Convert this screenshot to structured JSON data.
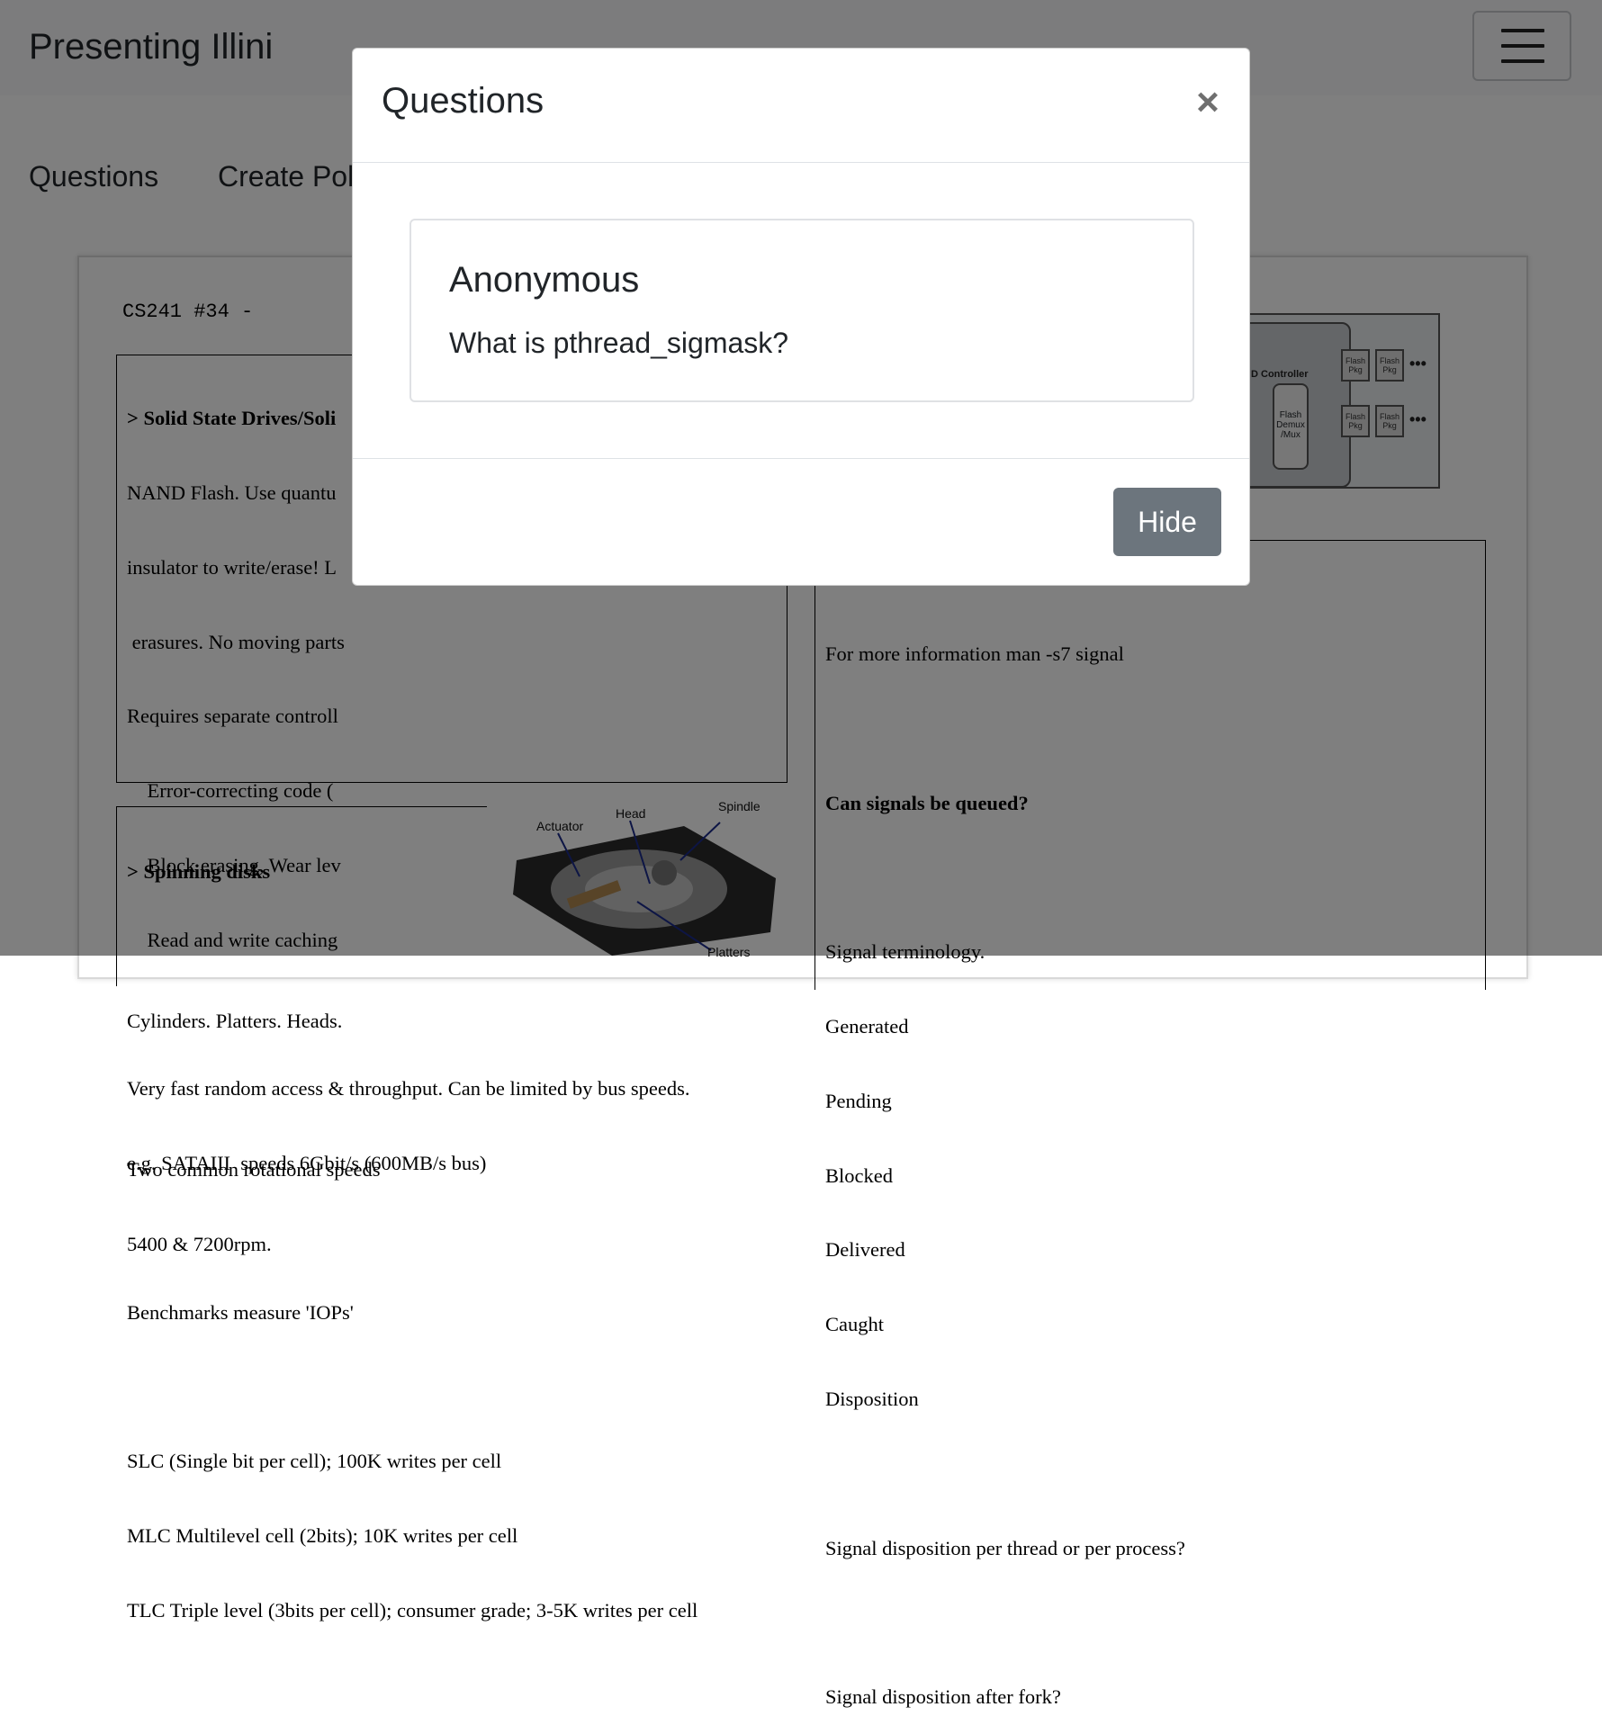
{
  "navbar": {
    "brand": "Presenting Illini",
    "menu_icon": "hamburger-icon"
  },
  "tabs": [
    "Questions",
    "Create Poll"
  ],
  "slide": {
    "title": "CS241 #34 -",
    "ssd_lines": [
      "> Solid State Drives/Soli",
      "NAND Flash. Use quantu",
      "insulator to write/erase! L",
      " erasures. No moving parts",
      "Requires separate controll",
      "    Error-correcting code (",
      "    Block erasing, Wear lev",
      "    Read and write caching",
      "",
      "Very fast random access & throughput. Can be limited by bus speeds.",
      "e.g. SATAIII  speeds 6Gbit/s (600MB/s bus)",
      "",
      "Benchmarks measure 'IOPs'",
      "",
      "SLC (Single bit per cell); 100K writes per cell",
      "MLC Multilevel cell (2bits); 10K writes per cell",
      "TLC Triple level (3bits per cell); consumer grade; 3-5K writes per cell"
    ],
    "spin_lines": [
      "> Spinning disks",
      "",
      "Cylinders. Platters. Heads.",
      "",
      "Two common rotational speeds",
      "5400 & 7200rpm."
    ],
    "signal_lines": [
      "For more information man -s7 signal",
      "",
      "Can signals be queued?",
      "",
      "Signal terminology.",
      "Generated",
      "Pending",
      "Blocked",
      "Delivered",
      "Caught",
      "Disposition",
      "",
      "Signal disposition per thread or per process?",
      "",
      "Signal disposition after fork?"
    ],
    "diagram": {
      "controller_label": "D Controller",
      "mux_label": "Flash Demux /Mux",
      "pkg_label": "Flash Pkg",
      "dots": "•••"
    },
    "hdd_labels": {
      "actuator": "Actuator",
      "head": "Head",
      "spindle": "Spindle",
      "platters": "Platters"
    }
  },
  "modal": {
    "title": "Questions",
    "close_icon": "close-icon",
    "close_glyph": "×",
    "question": {
      "author": "Anonymous",
      "text": "What is pthread_sigmask?"
    },
    "hide_label": "Hide"
  }
}
